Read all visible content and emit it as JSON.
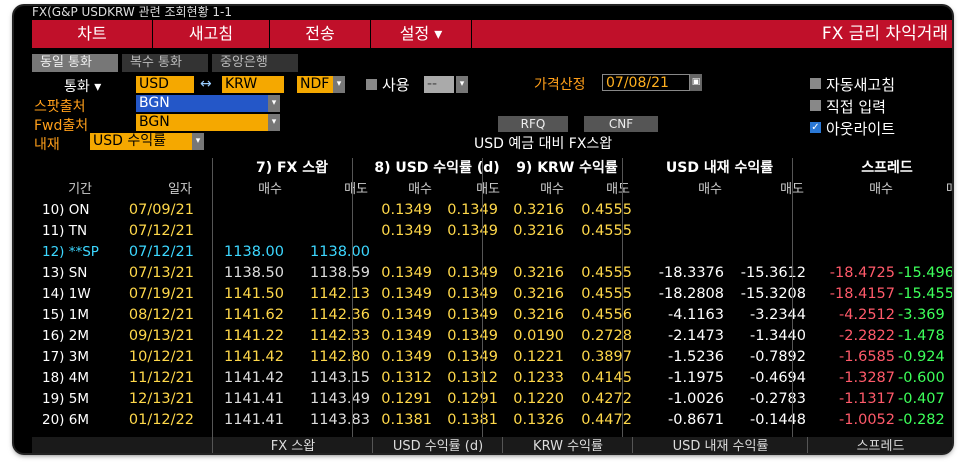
{
  "top_title": "FX(G&P USDKRW 관련 조회현황 1-1",
  "menu": {
    "items": [
      "차트",
      "새고침",
      "전송",
      "설정 ▾"
    ],
    "title": "FX 금리 차익거래"
  },
  "tabs": [
    "동일 통화",
    "복수 통화",
    "중앙은행"
  ],
  "form": {
    "currency_label": "통화 ▾",
    "ccy1": "USD",
    "arrow": "↔",
    "ccy2": "KRW",
    "ndf": "NDF",
    "use_label": "사용",
    "use_value": "--",
    "spot_label": "스팟출처",
    "spot_value": "BGN",
    "fwd_label": "Fwd출처",
    "fwd_value": "BGN",
    "implied_label": "내재",
    "implied_value": "USD 수익률",
    "price_date_label": "가격산정",
    "price_date": "07/08/21",
    "auto_refresh": "자동새고침",
    "direct_input": "직접 입력",
    "outline": "아웃라이트",
    "rfq": "RFQ",
    "cnf": "CNF",
    "caption": "USD 예금 대비 FX스왑"
  },
  "colors": {
    "menu": "#c0102a",
    "orange": "#ff9f1a",
    "field": "#f5a800",
    "yellow": "#ffd84a",
    "cyan": "#3cd7ff",
    "red": "#ff5a6a",
    "green": "#3dff5a"
  },
  "headers": {
    "group": [
      "7) FX 스왑",
      "8) USD 수익률 (d)",
      "9) KRW 수익률",
      "USD 내재 수익률",
      "스프레드"
    ],
    "sub": [
      "기간",
      "일자",
      "매수",
      "매도",
      "매수",
      "매도",
      "매수",
      "매도",
      "매수",
      "매도",
      "매수",
      "매"
    ]
  },
  "rows": [
    {
      "tenor": "10) ON",
      "date": "07/09/21",
      "fxb": "",
      "fxa": "",
      "usdb": "0.1349",
      "usda": "0.1349",
      "krwb": "0.3216",
      "krwa": "0.4555",
      "impb": "",
      "impa": "",
      "spb": "",
      "spa": ""
    },
    {
      "tenor": "11) TN",
      "date": "07/12/21",
      "fxb": "",
      "fxa": "",
      "usdb": "0.1349",
      "usda": "0.1349",
      "krwb": "0.3216",
      "krwa": "0.4555",
      "impb": "",
      "impa": "",
      "spb": "",
      "spa": ""
    },
    {
      "tenor": "12) **SP",
      "date": "07/12/21",
      "fxb": "1138.00",
      "fxa": "1138.00",
      "usdb": "",
      "usda": "",
      "krwb": "",
      "krwa": "",
      "impb": "",
      "impa": "",
      "spb": "",
      "spa": ""
    },
    {
      "tenor": "13) SN",
      "date": "07/13/21",
      "fxb": "1138.50",
      "fxa": "1138.59",
      "usdb": "0.1349",
      "usda": "0.1349",
      "krwb": "0.3216",
      "krwa": "0.4555",
      "impb": "-18.3376",
      "impa": "-15.3612",
      "spb": "-18.4725",
      "spa": "-15.496"
    },
    {
      "tenor": "14) 1W",
      "date": "07/19/21",
      "fxb": "1141.50",
      "fxa": "1142.13",
      "usdb": "0.1349",
      "usda": "0.1349",
      "krwb": "0.3216",
      "krwa": "0.4555",
      "impb": "-18.2808",
      "impa": "-15.3208",
      "spb": "-18.4157",
      "spa": "-15.455"
    },
    {
      "tenor": "15) 1M",
      "date": "08/12/21",
      "fxb": "1141.62",
      "fxa": "1142.36",
      "usdb": "0.1349",
      "usda": "0.1349",
      "krwb": "0.3216",
      "krwa": "0.4556",
      "impb": "-4.1163",
      "impa": "-3.2344",
      "spb": "-4.2512",
      "spa": "-3.369"
    },
    {
      "tenor": "16) 2M",
      "date": "09/13/21",
      "fxb": "1141.22",
      "fxa": "1142.33",
      "usdb": "0.1349",
      "usda": "0.1349",
      "krwb": "0.0190",
      "krwa": "0.2728",
      "impb": "-2.1473",
      "impa": "-1.3440",
      "spb": "-2.2822",
      "spa": "-1.478"
    },
    {
      "tenor": "17) 3M",
      "date": "10/12/21",
      "fxb": "1141.42",
      "fxa": "1142.80",
      "usdb": "0.1349",
      "usda": "0.1349",
      "krwb": "0.1221",
      "krwa": "0.3897",
      "impb": "-1.5236",
      "impa": "-0.7892",
      "spb": "-1.6585",
      "spa": "-0.924"
    },
    {
      "tenor": "18) 4M",
      "date": "11/12/21",
      "fxb": "1141.42",
      "fxa": "1143.15",
      "usdb": "0.1312",
      "usda": "0.1312",
      "krwb": "0.1233",
      "krwa": "0.4145",
      "impb": "-1.1975",
      "impa": "-0.4694",
      "spb": "-1.3287",
      "spa": "-0.600"
    },
    {
      "tenor": "19) 5M",
      "date": "12/13/21",
      "fxb": "1141.41",
      "fxa": "1143.49",
      "usdb": "0.1291",
      "usda": "0.1291",
      "krwb": "0.1220",
      "krwa": "0.4272",
      "impb": "-1.0026",
      "impa": "-0.2783",
      "spb": "-1.1317",
      "spa": "-0.407"
    },
    {
      "tenor": "20) 6M",
      "date": "01/12/22",
      "fxb": "1141.41",
      "fxa": "1143.83",
      "usdb": "0.1381",
      "usda": "0.1381",
      "krwb": "0.1326",
      "krwa": "0.4472",
      "impb": "-0.8671",
      "impa": "-0.1448",
      "spb": "-1.0052",
      "spa": "-0.282"
    }
  ],
  "footer": [
    "FX 스왑",
    "USD 수익률 (d)",
    "KRW 수익률",
    "USD 내재 수익률",
    "스프레드"
  ]
}
